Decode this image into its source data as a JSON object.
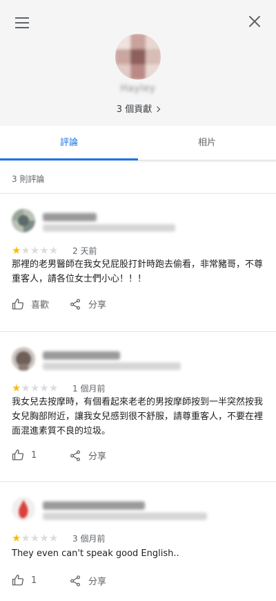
{
  "header": {
    "user_name": "Hayley",
    "contributions_label": "3 個貢獻"
  },
  "tabs": [
    {
      "label": "評論",
      "active": true
    },
    {
      "label": "相片",
      "active": false
    }
  ],
  "review_count_label": "3 則評論",
  "reviews": [
    {
      "rating": 1,
      "max_rating": 5,
      "time": "2 天前",
      "text": "那裡的老男醫師在我女兒屁股打針時跑去偷看，非常豬哥，不尊重客人，請各位女士們小心！！！",
      "like_label": "喜歡",
      "share_label": "分享"
    },
    {
      "rating": 1,
      "max_rating": 5,
      "time": "1 個月前",
      "text": "我女兒去按摩時，有個看起來老老的男按摩師按到一半突然按我女兒胸部附近，讓我女兒感到很不舒服，請尊重客人，不要在裡面混進素質不良的垃圾。",
      "like_label": "1",
      "share_label": "分享"
    },
    {
      "rating": 1,
      "max_rating": 5,
      "time": "3 個月前",
      "text": "They even can't speak good English..",
      "like_label": "1",
      "share_label": "分享"
    }
  ],
  "colors": {
    "accent": "#1a73e8",
    "star": "#fbbc04",
    "star_empty": "#dadce0",
    "header_bg": "#f5f5f5"
  },
  "icons": [
    "menu-icon",
    "close-icon",
    "chevron-right-icon",
    "thumbs-up-icon",
    "share-icon",
    "star-icon"
  ]
}
